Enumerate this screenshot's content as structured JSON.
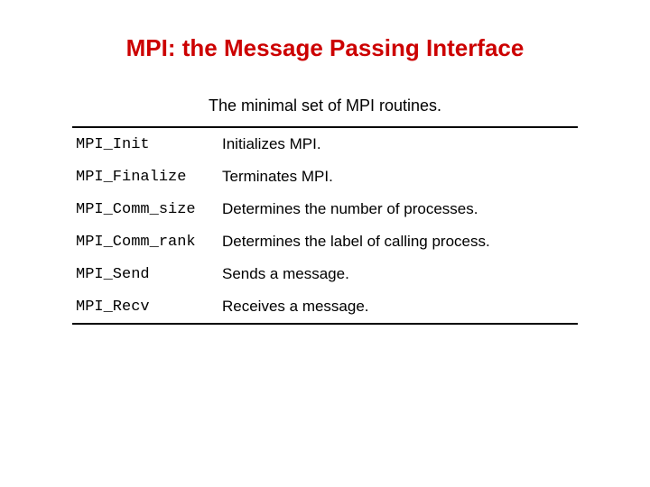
{
  "title": "MPI: the Message Passing Interface",
  "subtitle": "The minimal set of MPI routines.",
  "rows": [
    {
      "name": "MPI_Init",
      "desc": "Initializes MPI."
    },
    {
      "name": "MPI_Finalize",
      "desc": "Terminates MPI."
    },
    {
      "name": "MPI_Comm_size",
      "desc": "Determines the number of processes."
    },
    {
      "name": "MPI_Comm_rank",
      "desc": "Determines the label of calling process."
    },
    {
      "name": "MPI_Send",
      "desc": "Sends a message."
    },
    {
      "name": "MPI_Recv",
      "desc": "Receives a message."
    }
  ]
}
